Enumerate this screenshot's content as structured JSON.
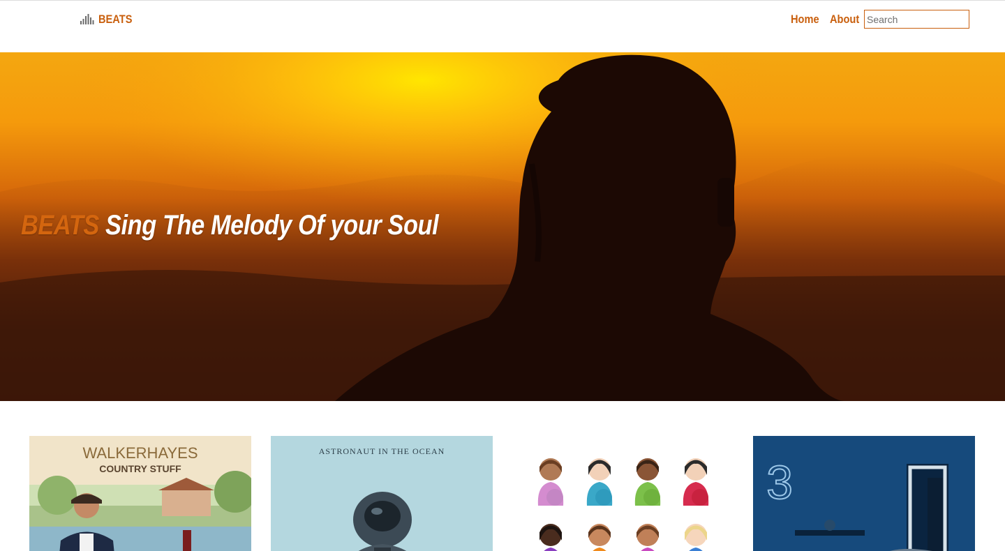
{
  "navbar": {
    "brand": "BEATS",
    "brand_icon": "sound-bars-icon",
    "links": [
      {
        "label": "Home"
      },
      {
        "label": "About"
      }
    ],
    "search_placeholder": "Search"
  },
  "hero": {
    "title_accent": "BEATS",
    "title_rest": " Sing The Melody Of your Soul"
  },
  "albums": [
    {
      "cover_line_1": "WALKERHAYES",
      "cover_line_2": "COUNTRY STUFF"
    },
    {
      "cover_line_1": "ASTRONAUT IN THE OCEAN"
    },
    {
      "cover_emoji": "pregnant-woman-emoji-grid"
    },
    {
      "cover_line_1": "3"
    }
  ],
  "colors": {
    "accent": "#c95f0d",
    "hero_accent": "#d4660f"
  }
}
